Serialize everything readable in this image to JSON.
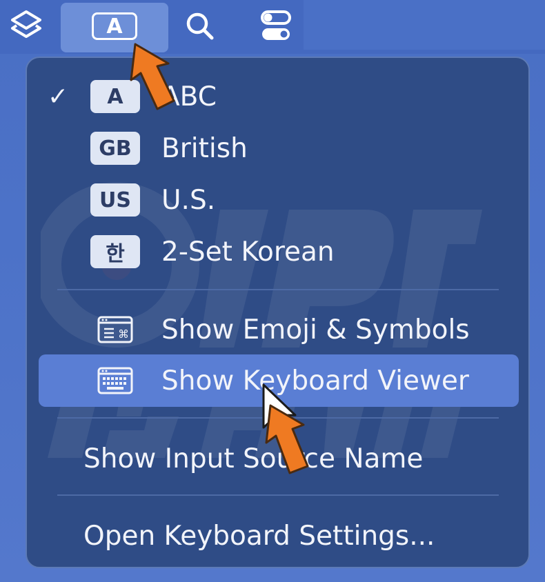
{
  "menubar": {
    "icons": [
      {
        "name": "layers-icon"
      },
      {
        "name": "input-source-icon",
        "glyph": "A"
      },
      {
        "name": "search-icon"
      },
      {
        "name": "control-center-icon"
      }
    ]
  },
  "menu": {
    "input_sources": [
      {
        "badge": "A",
        "label": "ABC",
        "checked": true,
        "check_glyph": "✓"
      },
      {
        "badge": "GB",
        "label": "British",
        "checked": false
      },
      {
        "badge": "US",
        "label": "U.S.",
        "checked": false
      },
      {
        "badge": "한",
        "label": "2-Set Korean",
        "checked": false
      }
    ],
    "show_emoji_label": "Show Emoji & Symbols",
    "show_keyboard_viewer_label": "Show Keyboard Viewer",
    "show_input_source_name_label": "Show Input Source Name",
    "open_keyboard_settings_label": "Open Keyboard Settings..."
  },
  "colors": {
    "accent_arrow": "#ef7a22",
    "highlight": "#5a7ed4",
    "menu_bg": "#2f4c86"
  }
}
